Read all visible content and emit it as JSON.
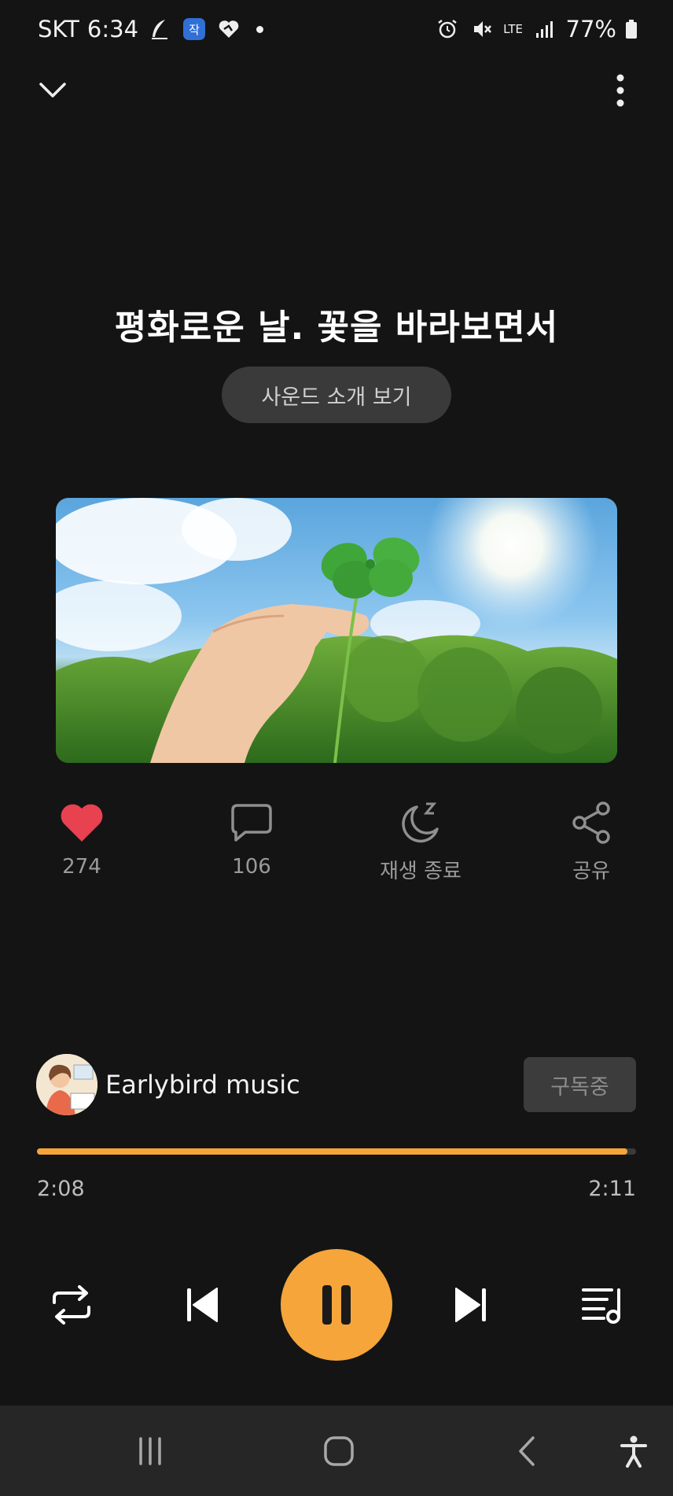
{
  "status_bar": {
    "carrier": "SKT",
    "time": "6:34",
    "network": "LTE",
    "battery": "77%",
    "icons": [
      "feather-icon",
      "app-badge-icon",
      "heart-hand-icon",
      "alarm-icon",
      "mute-icon",
      "signal-icon",
      "battery-icon"
    ]
  },
  "header": {
    "collapse_icon": "chevron-down-icon",
    "menu_icon": "more-vertical-icon"
  },
  "track": {
    "title": "평화로운 날. 꽃을 바라보면서",
    "intro_button": "사운드 소개 보기"
  },
  "actions": {
    "like_count": "274",
    "comment_count": "106",
    "sleep_label": "재생 종료",
    "share_label": "공유"
  },
  "artist": {
    "name": "Earlybird music",
    "subscribe_label": "구독중"
  },
  "playback": {
    "elapsed": "2:08",
    "duration": "2:11",
    "progress": 0.985
  },
  "colors": {
    "accent": "#f5a53a",
    "like": "#e8414f",
    "background": "#141414"
  }
}
